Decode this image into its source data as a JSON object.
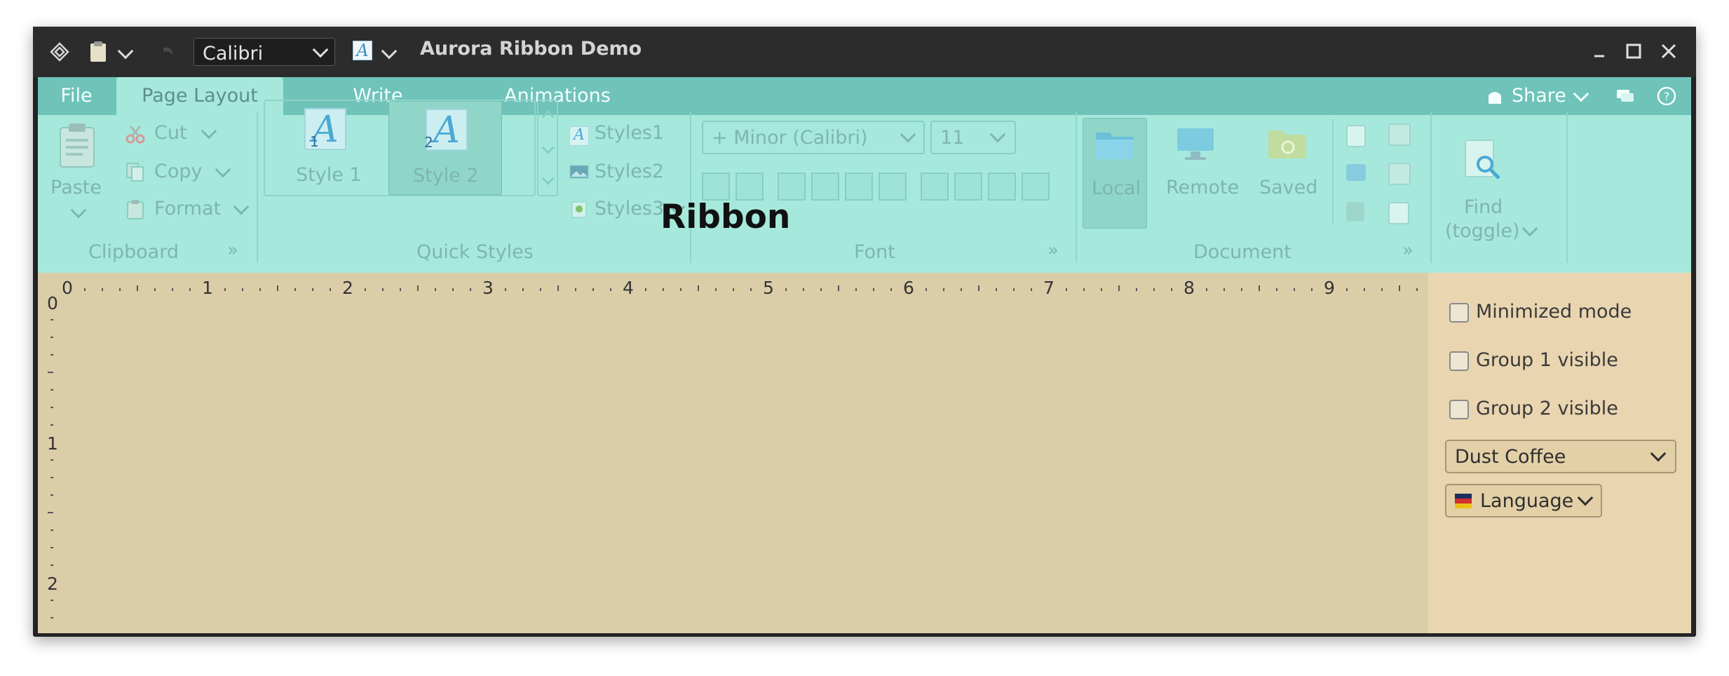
{
  "window": {
    "title": "Aurora Ribbon Demo"
  },
  "taskbar": {
    "font_name": "Calibri",
    "font_style_letter": "A"
  },
  "tabs": [
    {
      "label": "File"
    },
    {
      "label": "Page Layout"
    },
    {
      "label": "Write"
    },
    {
      "label": "Animations"
    }
  ],
  "share": {
    "label": "Share"
  },
  "clipboard": {
    "paste": "Paste",
    "cut": "Cut",
    "copy": "Copy",
    "format": "Format",
    "group_label": "Clipboard"
  },
  "quick_styles": {
    "style1": "Style 1",
    "style1_num": "1",
    "style2": "Style 2",
    "style2_num": "2",
    "letter": "A",
    "styles1": "Styles1",
    "styles2": "Styles2",
    "styles3": "Styles3",
    "group_label": "Quick Styles"
  },
  "font": {
    "family": "+ Minor (Calibri)",
    "size": "11",
    "group_label": "Font"
  },
  "document": {
    "local": "Local",
    "remote": "Remote",
    "saved": "Saved",
    "group_label": "Document"
  },
  "find": {
    "line1": "Find",
    "line2": "(toggle)"
  },
  "overlay_label": "Ribbon",
  "ruler": {
    "h": [
      "0",
      "1",
      "2",
      "3",
      "4",
      "5",
      "6",
      "7",
      "8",
      "9"
    ],
    "v": [
      "0",
      "1",
      "2"
    ]
  },
  "panel": {
    "minimized": "Minimized mode",
    "group1": "Group 1 visible",
    "group2": "Group 2 visible",
    "skin": "Dust Coffee",
    "language": "Language"
  },
  "colors": {
    "ribbon_bg": "#a6e9dc",
    "tab_strip": "#6fc3b9",
    "content_bg": "#dccda9",
    "panel_bg": "#e9d5b0"
  }
}
